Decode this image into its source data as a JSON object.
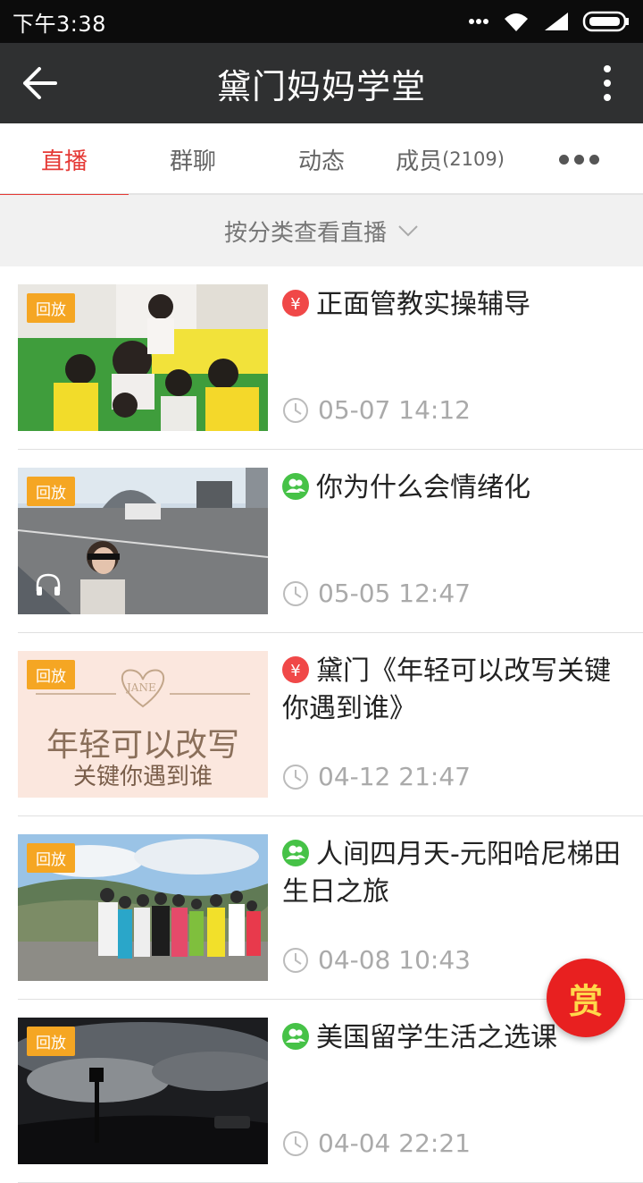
{
  "status_bar": {
    "time": "下午3:38"
  },
  "app_bar": {
    "title": "黛门妈妈学堂"
  },
  "tabs": [
    {
      "label": "直播",
      "active": true
    },
    {
      "label": "群聊",
      "active": false
    },
    {
      "label": "动态",
      "active": false
    },
    {
      "label": "成员",
      "count": "(2109)",
      "active": false
    }
  ],
  "filter": {
    "label": "按分类查看直播"
  },
  "badge_label": "回放",
  "items": [
    {
      "title": "正面管教实操辅导",
      "type": "paid",
      "time": "05-07 14:12"
    },
    {
      "title": "你为什么会情绪化",
      "type": "group",
      "time": "05-05 12:47",
      "audio": true
    },
    {
      "title": "黛门《年轻可以改写关键你遇到谁》",
      "type": "paid",
      "time": "04-12 21:47",
      "cover_text": {
        "tag": "JANE",
        "line1": "年轻可以改写",
        "line2": "关键你遇到谁"
      }
    },
    {
      "title": "人间四月天-元阳哈尼梯田生日之旅",
      "type": "group",
      "time": "04-08 10:43"
    },
    {
      "title": "美国留学生活之选课",
      "type": "group",
      "time": "04-04 22:21"
    }
  ],
  "fab": {
    "label": "赏"
  },
  "colors": {
    "accent": "#e53935",
    "badge": "#f5a623",
    "paid": "#f04848",
    "group": "#46c247"
  }
}
